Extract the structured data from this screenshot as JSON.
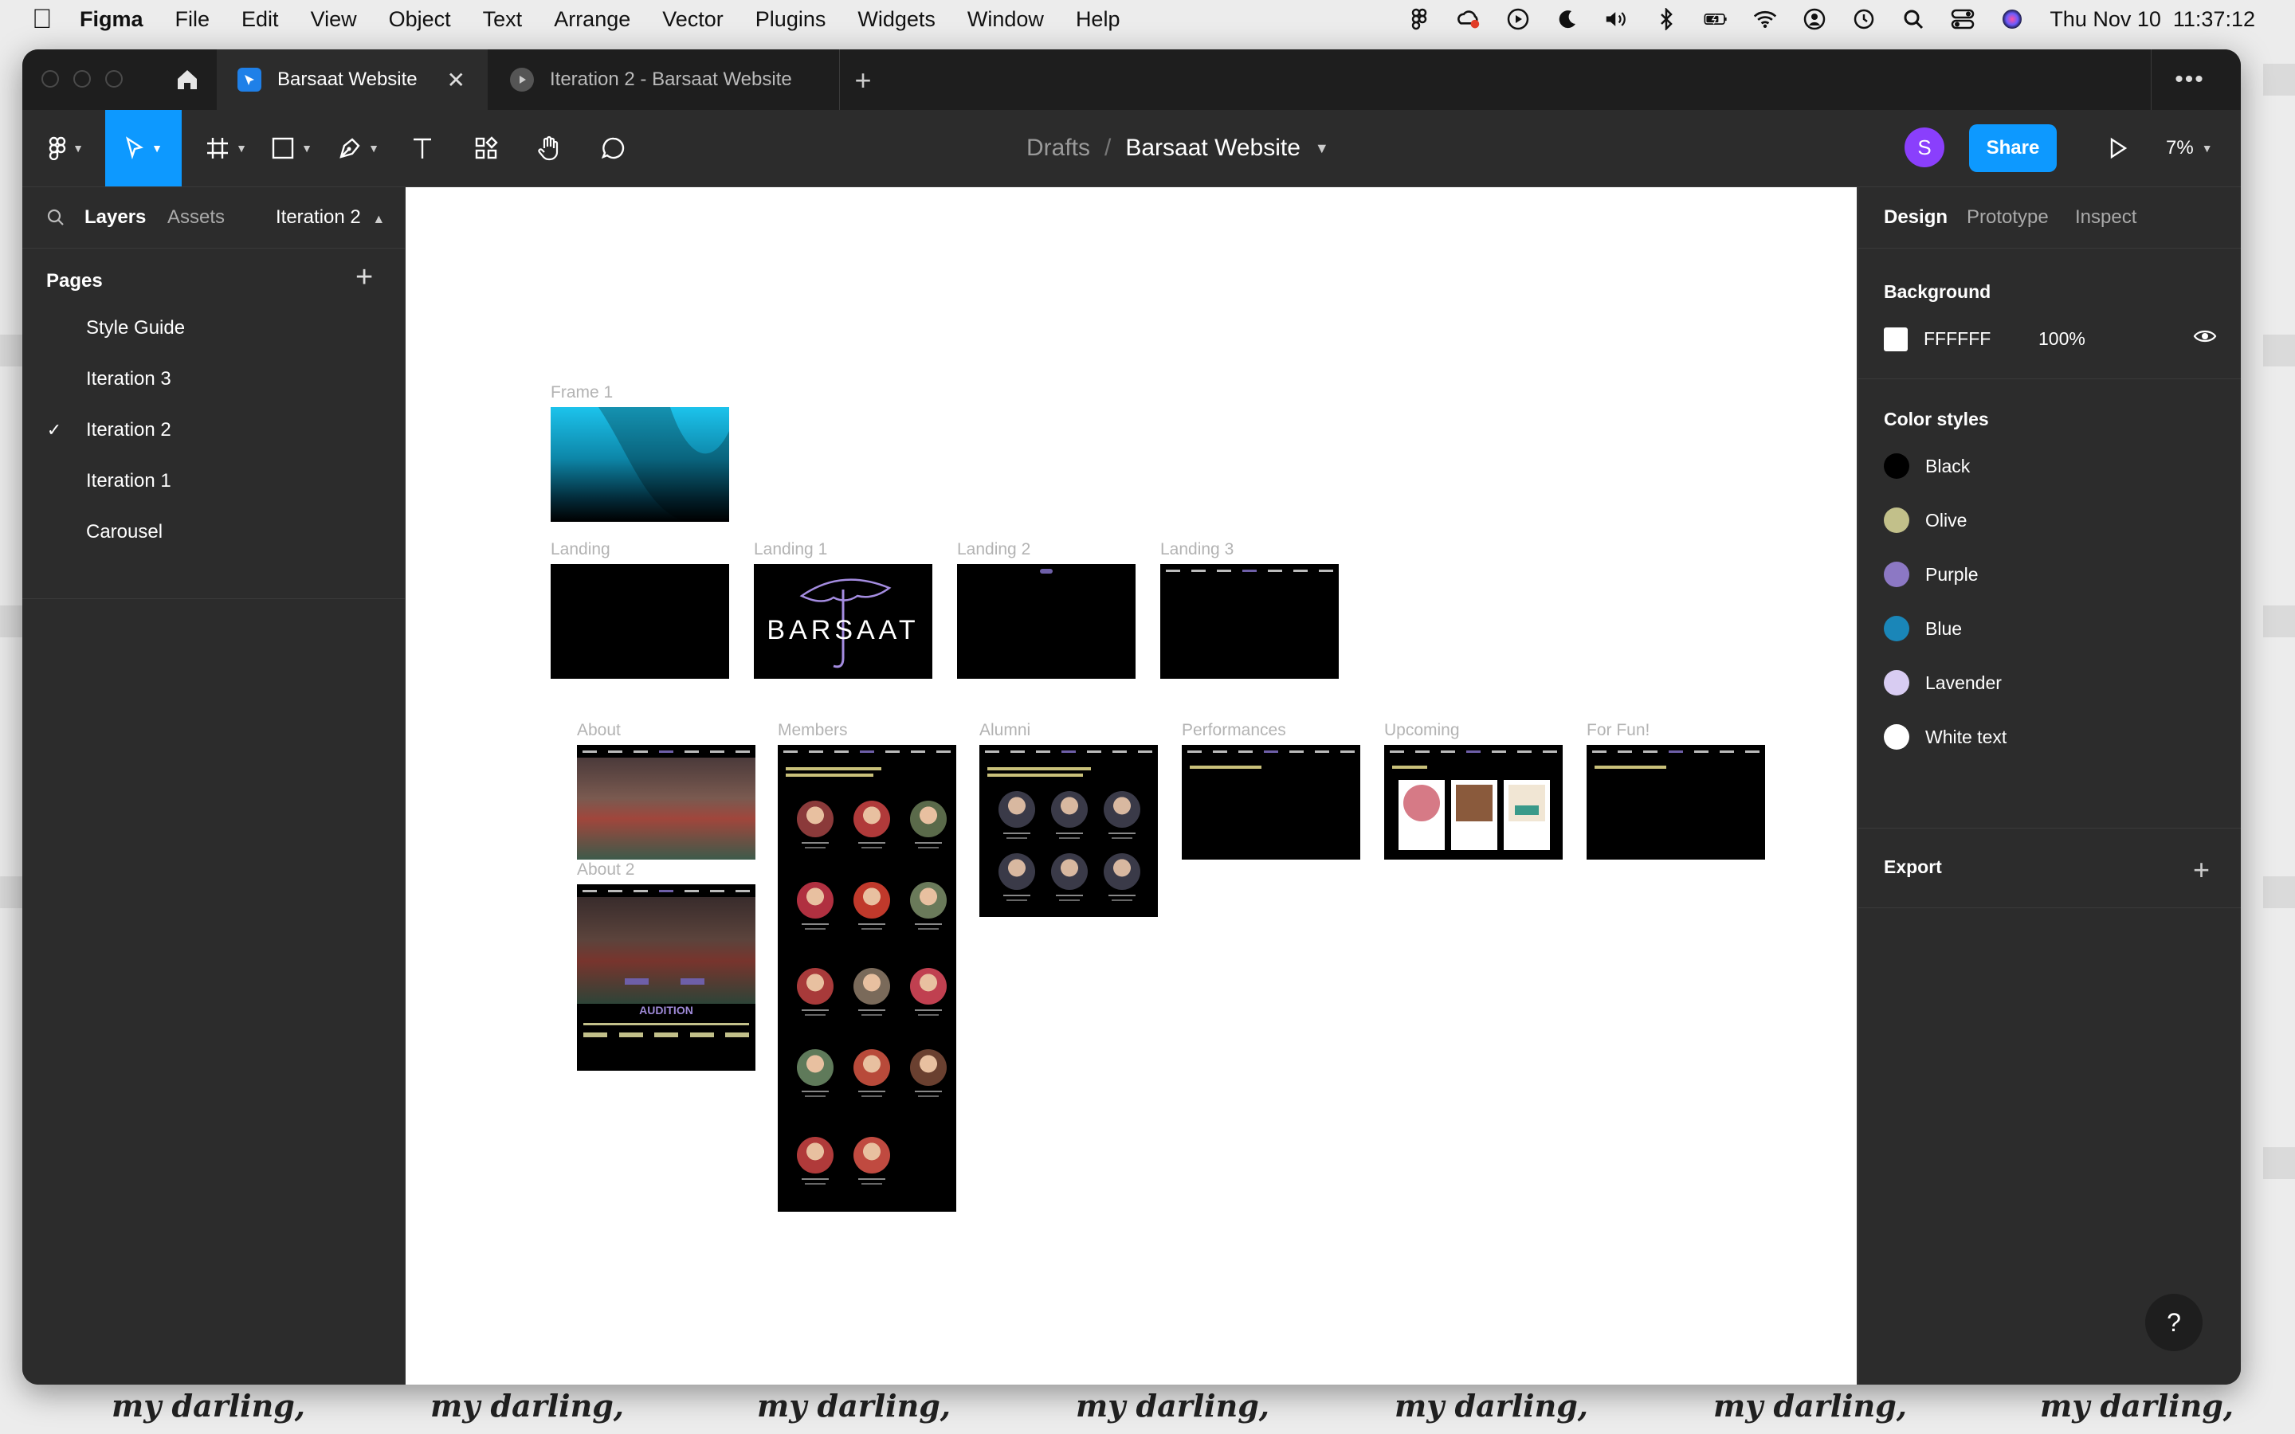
{
  "menubar": {
    "app_name": "Figma",
    "menus": [
      "File",
      "Edit",
      "View",
      "Object",
      "Text",
      "Arrange",
      "Vector",
      "Plugins",
      "Widgets",
      "Window",
      "Help"
    ],
    "datetime": "Thu Nov 10  11:37:12"
  },
  "tabs": {
    "active_label": "Barsaat Website",
    "inactive_label": "Iteration 2 - Barsaat Website"
  },
  "toolbar": {
    "breadcrumb_root": "Drafts",
    "breadcrumb_sep": "/",
    "file_name": "Barsaat Website",
    "avatar_initial": "S",
    "share_label": "Share",
    "zoom_level": "7%"
  },
  "left_panel": {
    "tab_layers": "Layers",
    "tab_assets": "Assets",
    "current_page": "Iteration 2",
    "pages_header": "Pages",
    "pages": [
      {
        "label": "Style Guide",
        "selected": false
      },
      {
        "label": "Iteration 3",
        "selected": false
      },
      {
        "label": "Iteration 2",
        "selected": true
      },
      {
        "label": "Iteration 1",
        "selected": false
      },
      {
        "label": "Carousel",
        "selected": false
      }
    ]
  },
  "canvas": {
    "frames": {
      "frame1": "Frame 1",
      "landing": "Landing",
      "landing1": "Landing 1",
      "landing2": "Landing 2",
      "landing3": "Landing 3",
      "about": "About",
      "about2": "About 2",
      "members": "Members",
      "alumni": "Alumni",
      "performances": "Performances",
      "upcoming": "Upcoming",
      "forfun": "For Fun!"
    },
    "landing1_logo_text": "BARSAAT",
    "about2_audition": "AUDITION"
  },
  "right_panel": {
    "tab_design": "Design",
    "tab_prototype": "Prototype",
    "tab_inspect": "Inspect",
    "background_title": "Background",
    "background_hex": "FFFFFF",
    "background_opacity": "100%",
    "color_styles_title": "Color styles",
    "color_styles": [
      {
        "name": "Black",
        "color": "#000000"
      },
      {
        "name": "Olive",
        "color": "#c2c08a"
      },
      {
        "name": "Purple",
        "color": "#8c78c4"
      },
      {
        "name": "Blue",
        "color": "#1a86b8"
      },
      {
        "name": "Lavender",
        "color": "#d8ccf2"
      },
      {
        "name": "White text",
        "color": "#ffffff"
      }
    ],
    "export_title": "Export"
  },
  "help_label": "?",
  "wallpaper_text": "my darling,",
  "colors": {
    "accent": "#0d99ff",
    "panel_bg": "#2c2c2c",
    "titlebar_bg": "#1e1e1e",
    "avatar": "#8a3ffc"
  }
}
